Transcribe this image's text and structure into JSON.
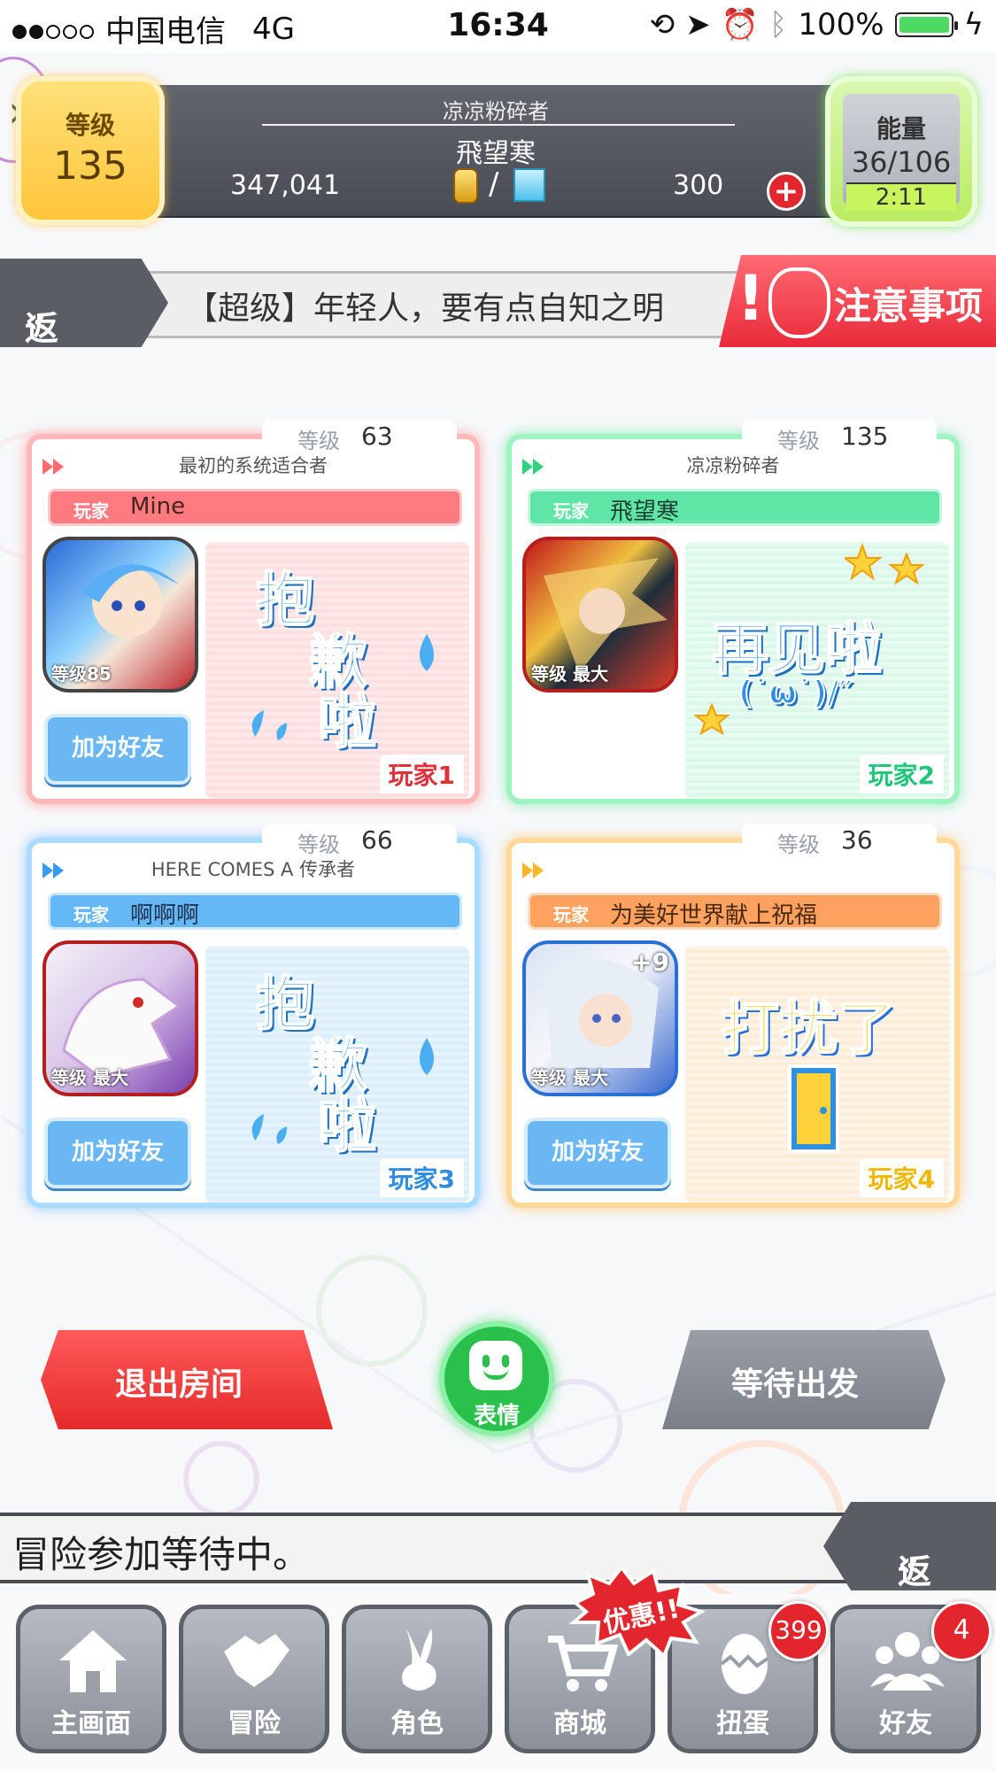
{
  "status_bar": {
    "carrier": "中国电信",
    "network": "4G",
    "time": "16:34",
    "battery": "100%"
  },
  "header": {
    "level_label": "等级",
    "level_value": "135",
    "title": "凉凉粉碎者",
    "player_name": "飛望寒",
    "coins": "347,041",
    "slash": "/",
    "gems": "300",
    "plus": "+",
    "energy_label": "能量",
    "energy_value": "36/106",
    "energy_timer": "2:11"
  },
  "quest_bar": {
    "back_label": "返回",
    "quest_title": "【超级】年轻人，要有点自知之明",
    "notice_label": "注意事项"
  },
  "players": [
    {
      "level_label": "等级",
      "level": "63",
      "title": "最初的系统适合者",
      "tag": "玩家",
      "name": "Mine",
      "avatar_level": "等级85",
      "add_friend": "加为好友",
      "stamp": [
        "抱",
        "歉",
        "啦"
      ],
      "slot": "玩家1"
    },
    {
      "level_label": "等级",
      "level": "135",
      "title": "凉凉粉碎者",
      "tag": "玩家",
      "name": "飛望寒",
      "avatar_level": "等级 最大",
      "stamp_line1": "再见啦",
      "stamp_line2": "(˙ω˙)/″",
      "slot": "玩家2"
    },
    {
      "level_label": "等级",
      "level": "66",
      "title": "HERE COMES A 传承者",
      "tag": "玩家",
      "name": "啊啊啊",
      "avatar_level": "等级 最大",
      "add_friend": "加为好友",
      "stamp": [
        "抱",
        "歉",
        "啦"
      ],
      "slot": "玩家3"
    },
    {
      "level_label": "等级",
      "level": "36",
      "title": "",
      "tag": "玩家",
      "name": "为美好世界献上祝福",
      "avatar_level": "等级 最大",
      "avatar_plus": "+9",
      "add_friend": "加为好友",
      "stamp_line1": "打扰了",
      "slot": "玩家4"
    }
  ],
  "controls": {
    "exit_room": "退出房间",
    "emote": "表情",
    "waiting": "等待出发"
  },
  "message_bar": {
    "text": "冒险参加等待中。",
    "back_label": "返回"
  },
  "tabbar": {
    "sale_label": "优惠!!",
    "tabs": [
      {
        "label": "主画面",
        "icon": "home-icon"
      },
      {
        "label": "冒险",
        "icon": "handshake-icon"
      },
      {
        "label": "角色",
        "icon": "bunny-icon"
      },
      {
        "label": "商城",
        "icon": "cart-icon"
      },
      {
        "label": "扭蛋",
        "icon": "egg-icon",
        "badge": "399"
      },
      {
        "label": "好友",
        "icon": "friends-icon",
        "badge": "4"
      }
    ]
  },
  "colors": {
    "player1": "#ff7b7f",
    "player2": "#5fe6a6",
    "player3": "#65b8f6",
    "player4": "#ffa25f",
    "exit_button": "#e52a2a",
    "emote_button": "#29c04c"
  }
}
